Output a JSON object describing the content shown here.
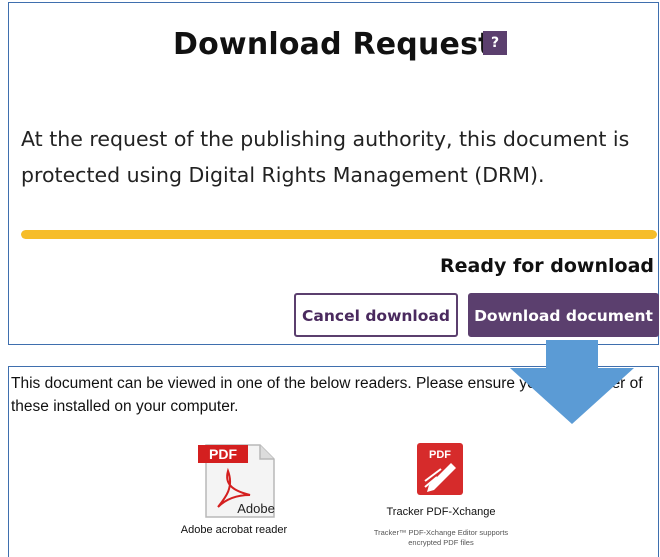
{
  "dialog": {
    "title": "Download Request",
    "help_label": "?",
    "message": "At the request of the publishing authority, this document is protected using Digital Rights Management (DRM).",
    "progress_fraction": 1.0,
    "status": "Ready for download",
    "cancel_label": "Cancel download",
    "download_label": "Download document"
  },
  "readers": {
    "note": "This document can be viewed in one of the below readers. Please ensure you have either of these installed on your computer.",
    "adobe": {
      "icon_text": "PDF",
      "brand": "Adobe",
      "name": "Adobe acrobat reader"
    },
    "tracker": {
      "icon_text": "PDF",
      "name": "Tracker PDF-Xchange",
      "desc": "Tracker™ PDF-Xchange Editor supports encrypted PDF files"
    }
  },
  "colors": {
    "accent": "#5b3f6e",
    "progress": "#f6bd2a",
    "border": "#3f6fae",
    "arrow": "#5b9bd5",
    "pdf_red": "#e02020"
  }
}
